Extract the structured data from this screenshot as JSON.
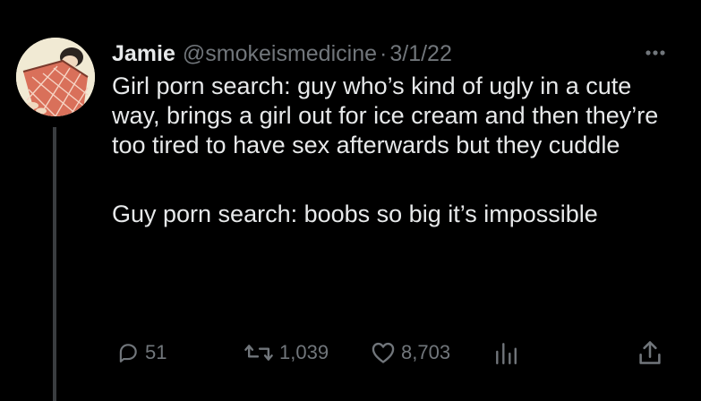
{
  "tweet": {
    "author_name": "Jamie",
    "handle": "@smokeismedicine",
    "separator": "·",
    "date": "3/1/22",
    "paragraphs": [
      "Girl porn search: guy who’s kind of ugly in a cute way, brings a girl out for ice cream and then they’re too tired to have sex afterwards but they cuddle",
      "Guy porn search: boobs so big it’s impossible"
    ],
    "actions": {
      "replies": "51",
      "retweets": "1,039",
      "likes": "8,703"
    },
    "icons": {
      "more": "more-icon",
      "reply": "reply-icon",
      "retweet": "retweet-icon",
      "like": "heart-icon",
      "views": "analytics-icon",
      "share": "share-icon"
    }
  },
  "colors": {
    "background": "#000000",
    "primary_text": "#e7e9ea",
    "secondary_text": "#71767b",
    "thread_line": "#3a3d40"
  }
}
